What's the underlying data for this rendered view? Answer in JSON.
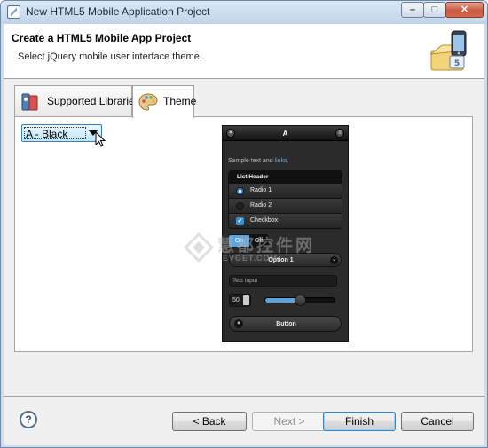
{
  "window": {
    "title": "New HTML5 Mobile Application Project",
    "min_glyph": "–",
    "max_glyph": "□",
    "close_glyph": "✕"
  },
  "banner": {
    "heading": "Create a HTML5 Mobile App Project",
    "subheading": "Select jQuery mobile user interface theme."
  },
  "tabs": [
    {
      "label": "Supported Libraries",
      "icon": "libraries-icon",
      "active": false
    },
    {
      "label": "Theme",
      "icon": "theme-palette-icon",
      "active": true
    }
  ],
  "theme_select": {
    "value": "A - Black"
  },
  "preview": {
    "header_title": "A",
    "left_btn": "✶",
    "right_btn": "≡",
    "sample_text": "Sample text and ",
    "sample_link": "links.",
    "list_header": "List Header",
    "items": [
      {
        "label": "Radio 1",
        "type": "radio",
        "checked": true
      },
      {
        "label": "Radio 2",
        "type": "radio",
        "checked": false
      },
      {
        "label": "Checkbox",
        "type": "checkbox",
        "checked": true
      }
    ],
    "toggle_on": "On",
    "toggle_off": "Off",
    "select_label": "Option 1",
    "select_chev": "⌄",
    "input_placeholder": "Text Input",
    "slider_value": "50",
    "slider_fraction": 0.5,
    "button_label": "Button",
    "button_icon": "✶",
    "check_glyph": "✔"
  },
  "watermark": {
    "text_cn": "慧都控件网",
    "url": "EVGET.COM"
  },
  "footer": {
    "help": "?",
    "back": "< Back",
    "next": "Next >",
    "finish": "Finish",
    "cancel": "Cancel"
  },
  "colors": {
    "accent": "#3c7fb1",
    "preview_accent": "#5ba3dd",
    "preview_bg": "#2b2b2b"
  }
}
